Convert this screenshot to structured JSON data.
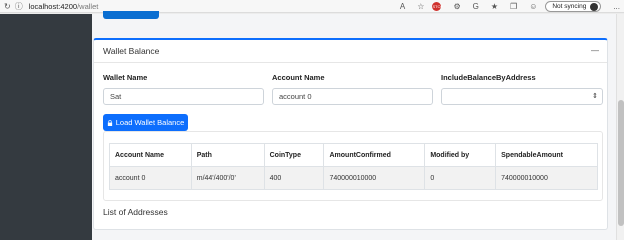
{
  "browser": {
    "url_host": "localhost:4200",
    "url_path": "/wallet",
    "sync_label": "Not syncing",
    "more_label": "..."
  },
  "card": {
    "title": "Wallet Balance",
    "collapse_symbol": "—"
  },
  "form": {
    "wallet_name_label": "Wallet Name",
    "wallet_name_value": "Sat",
    "account_name_label": "Account Name",
    "account_name_value": "account 0",
    "include_balance_label": "IncludeBalanceByAddress",
    "include_balance_value": "",
    "load_button_label": "Load Wallet Balance"
  },
  "table": {
    "headers": [
      "Account Name",
      "Path",
      "CoinType",
      "AmountConfirmed",
      "Modified by",
      "SpendableAmount"
    ],
    "rows": [
      [
        "account 0",
        "m/44'/400'/0'",
        "400",
        "740000010000",
        "0",
        "740000010000"
      ]
    ]
  },
  "addresses": {
    "title": "List of Addresses"
  },
  "colors": {
    "primary": "#0d6efd",
    "sidebar": "#343a40"
  }
}
